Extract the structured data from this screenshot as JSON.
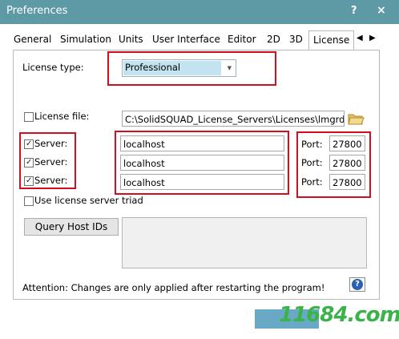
{
  "window": {
    "title": "Preferences",
    "help_glyph": "?",
    "close_glyph": "×"
  },
  "tabs": [
    {
      "label": "General"
    },
    {
      "label": "Simulation"
    },
    {
      "label": "Units"
    },
    {
      "label": "User Interface"
    },
    {
      "label": "Editor"
    },
    {
      "label": "2D"
    },
    {
      "label": "3D"
    },
    {
      "label": "License",
      "active": true
    }
  ],
  "tab_scroll": {
    "left": "◀",
    "right": "▶"
  },
  "license": {
    "type_label": "License type:",
    "type_value": "Professional",
    "file_label": "License file:",
    "file_checked": false,
    "file_path": "C:\\SolidSQUAD_License_Servers\\Licenses\\lmgrd_SSQ.lic",
    "servers": [
      {
        "label": "Server:",
        "checked": true,
        "host": "localhost",
        "port_label": "Port:",
        "port": "27800"
      },
      {
        "label": "Server:",
        "checked": true,
        "host": "localhost",
        "port_label": "Port:",
        "port": "27800"
      },
      {
        "label": "Server:",
        "checked": true,
        "host": "localhost",
        "port_label": "Port:",
        "port": "27800"
      }
    ],
    "triad_label": "Use license server triad",
    "triad_checked": false,
    "query_button": "Query Host IDs",
    "attention": "Attention: Changes are only applied after restarting the program!",
    "info_glyph": "?"
  },
  "watermark": {
    "text": "11684.com"
  },
  "colors": {
    "titlebar": "#5e9aa6",
    "highlight_box": "#d40d1f",
    "selection": "#c2e3ef"
  }
}
